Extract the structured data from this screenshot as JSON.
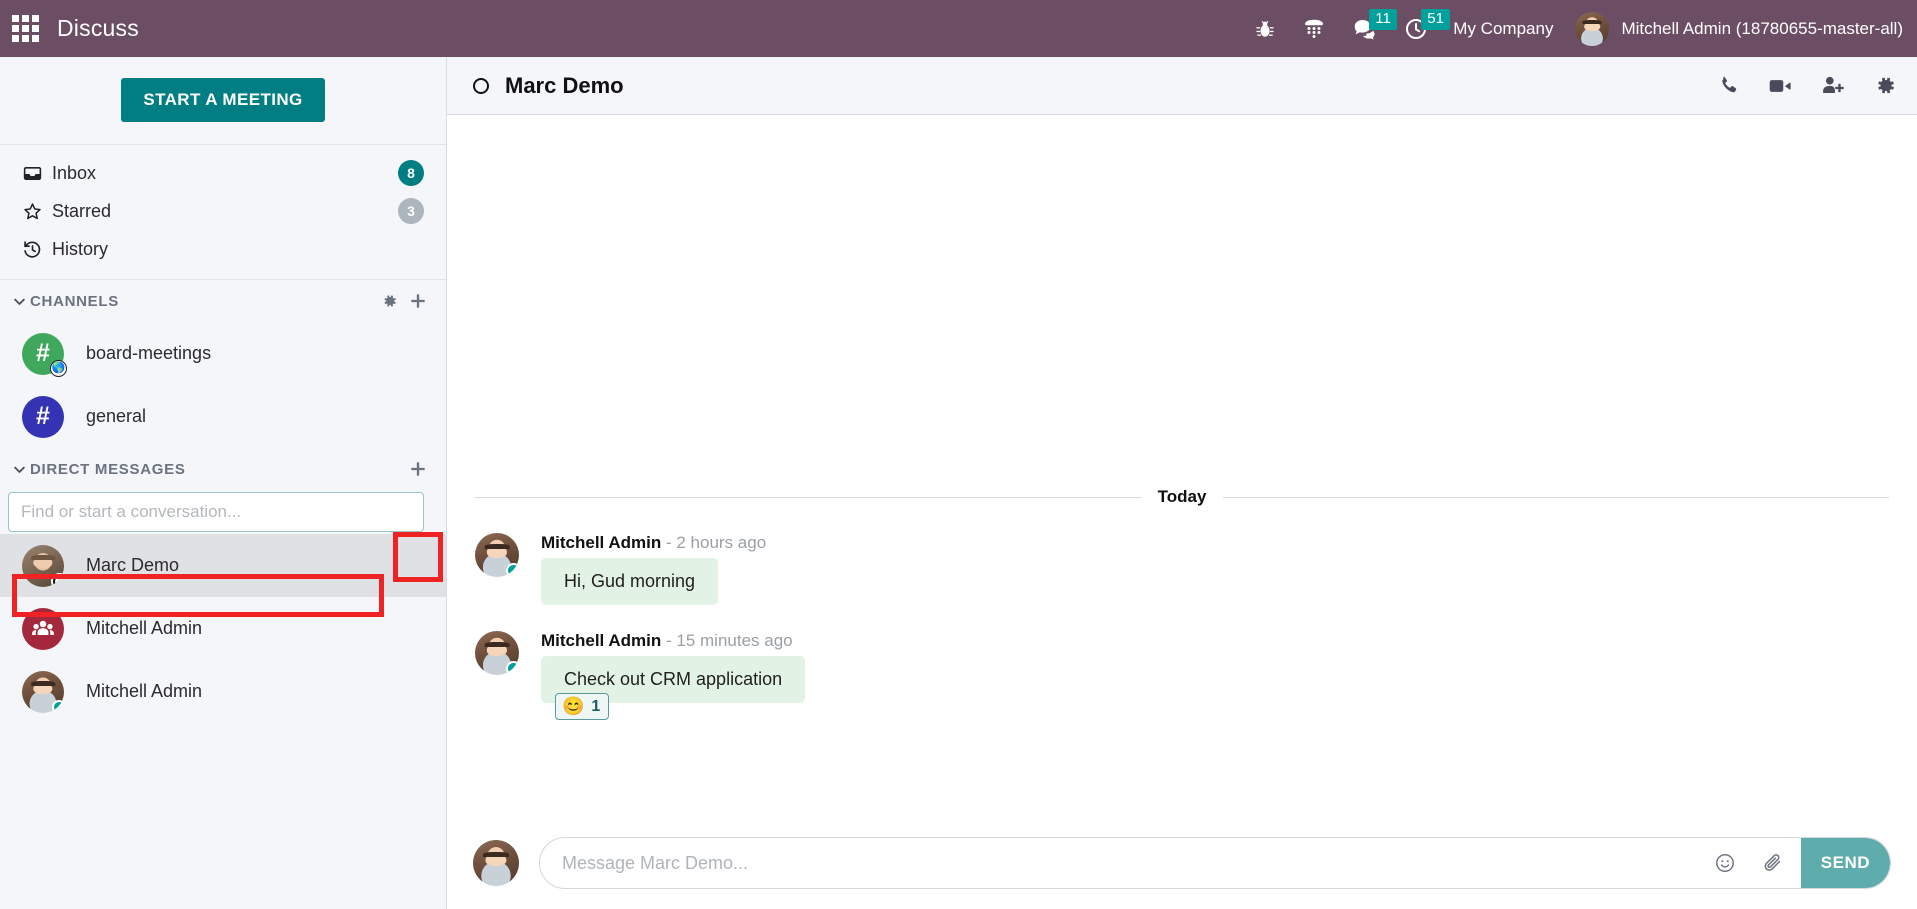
{
  "navbar": {
    "apps_icon": "apps-grid-icon",
    "brand": "Discuss",
    "icons": [
      {
        "name": "bug-icon",
        "badge": null
      },
      {
        "name": "dialpad-icon",
        "badge": null
      },
      {
        "name": "messages-icon",
        "badge": "11"
      },
      {
        "name": "activities-clock-icon",
        "badge": "51"
      }
    ],
    "company": "My Company",
    "user": "Mitchell Admin (18780655-master-all)",
    "bar_color": "#6B4E63",
    "badge_color": "#00A09D"
  },
  "sidebar": {
    "start_meeting_label": "START A MEETING",
    "mailboxes": [
      {
        "label": "Inbox",
        "icon": "inbox-icon",
        "count": "8",
        "count_style": "teal"
      },
      {
        "label": "Starred",
        "icon": "star-icon",
        "count": "3",
        "count_style": "grey"
      },
      {
        "label": "History",
        "icon": "history-icon",
        "count": "",
        "count_style": "none"
      }
    ],
    "channels_group": {
      "title": "CHANNELS",
      "settings_icon": "gear-icon",
      "add_icon": "plus-icon",
      "items": [
        {
          "label": "board-meetings",
          "avatar": "hash-icon",
          "color": "#3FA85C",
          "sub_badge": "globe-icon"
        },
        {
          "label": "general",
          "avatar": "hash-icon",
          "color": "#3333B3",
          "sub_badge": ""
        }
      ]
    },
    "dm_group": {
      "title": "DIRECT MESSAGES",
      "add_icon": "plus-icon",
      "search_placeholder": "Find or start a conversation...",
      "search_value": "",
      "items": [
        {
          "label": "Marc Demo",
          "avatar": "photo-marc",
          "status": "offline",
          "active": true
        },
        {
          "label": "Mitchell Admin",
          "avatar": "group-icon",
          "status": "none",
          "active": false
        },
        {
          "label": "Mitchell Admin",
          "avatar": "photo-admin",
          "status": "online",
          "active": false
        }
      ]
    }
  },
  "chat": {
    "header": {
      "status_icon": "circle-offline-icon",
      "title": "Marc Demo",
      "actions": [
        {
          "name": "phone-call-icon"
        },
        {
          "name": "video-camera-icon"
        },
        {
          "name": "add-user-icon"
        },
        {
          "name": "gear-icon"
        }
      ]
    },
    "day_separator": "Today",
    "messages": [
      {
        "author": "Mitchell Admin",
        "time": "- 2 hours ago",
        "text": "Hi, Gud morning",
        "avatar": "photo-admin",
        "status": "online",
        "reactions": []
      },
      {
        "author": "Mitchell Admin",
        "time": "- 15 minutes ago",
        "text": "Check out CRM application",
        "avatar": "photo-admin",
        "status": "online",
        "reactions": [
          {
            "emoji": "😊",
            "count": "1"
          }
        ]
      }
    ],
    "composer": {
      "placeholder": "Message Marc Demo...",
      "value": "",
      "emoji_icon": "smiley-icon",
      "attach_icon": "paperclip-icon",
      "send_label": "SEND",
      "send_color": "#5FACAC"
    }
  },
  "highlights": [
    {
      "name": "highlight-dm-add-button",
      "color": "#ef2323"
    },
    {
      "name": "highlight-dm-search-input",
      "color": "#ef2323"
    }
  ]
}
